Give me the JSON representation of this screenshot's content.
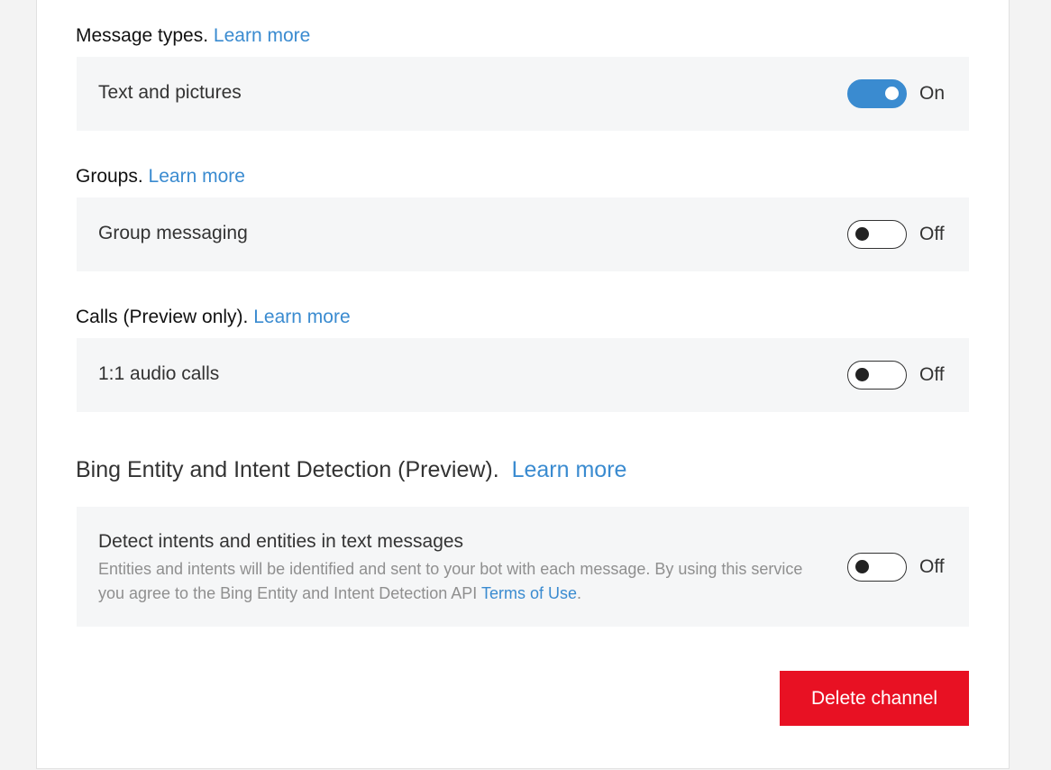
{
  "sections": {
    "message_types": {
      "title": "Message types.",
      "link": "Learn more",
      "row_label": "Text and pictures",
      "state": "On"
    },
    "groups": {
      "title": "Groups.",
      "link": "Learn more",
      "row_label": "Group messaging",
      "state": "Off"
    },
    "calls": {
      "title": "Calls (Preview only).",
      "link": "Learn more",
      "row_label": "1:1 audio calls",
      "state": "Off"
    },
    "bing": {
      "title": "Bing Entity and Intent Detection (Preview).",
      "link": "Learn more",
      "row_label": "Detect intents and entities in text messages",
      "description": "Entities and intents will be identified and sent to your bot with each message. By using this service you agree to the Bing Entity and Intent Detection API",
      "terms_link": "Terms of Use",
      "terms_suffix": ".",
      "state": "Off"
    }
  },
  "delete_button": "Delete channel",
  "colors": {
    "accent": "#3a8bd0",
    "danger": "#e81123",
    "row_bg": "#f5f6f7"
  }
}
